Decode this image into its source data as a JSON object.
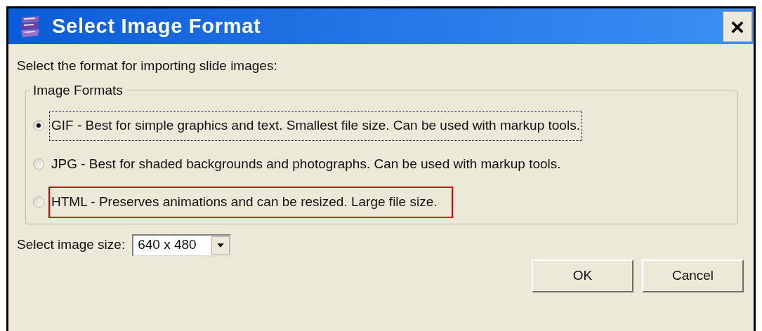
{
  "window": {
    "title": "Select Image Format",
    "close": "×"
  },
  "prompt": "Select the format for importing slide images:",
  "group": {
    "label": "Image Formats",
    "options": [
      {
        "label": "GIF - Best for simple graphics and text.  Smallest file size.  Can be used with markup tools.",
        "selected": true,
        "highlighted": false
      },
      {
        "label": "JPG - Best for shaded backgrounds and photographs.  Can be used with markup tools.",
        "selected": false,
        "highlighted": false
      },
      {
        "label": "HTML - Preserves animations and can be resized.  Large file size.",
        "selected": false,
        "highlighted": true
      }
    ]
  },
  "size": {
    "label": "Select image size:",
    "value": "640 x 480"
  },
  "buttons": [
    "OK",
    "Cancel"
  ]
}
